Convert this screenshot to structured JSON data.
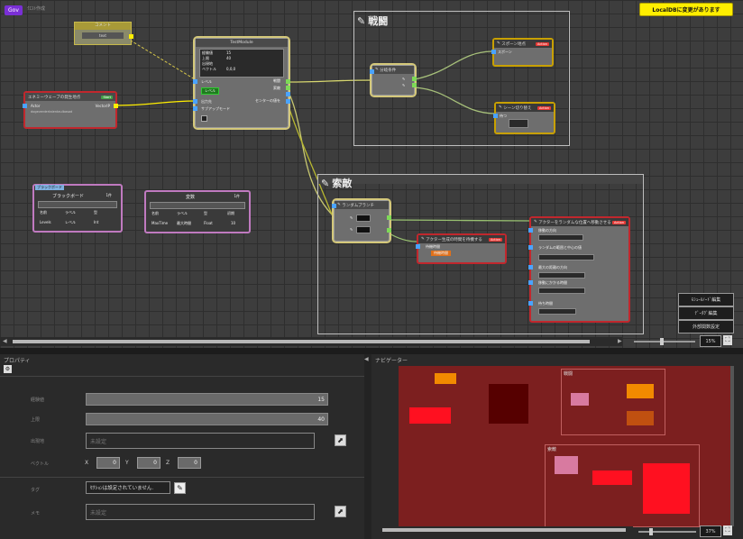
{
  "app": {
    "badge": "Gov",
    "caption": "ｸｴｽﾄ作成"
  },
  "localdb_button": "LocalDBに変更があります",
  "groups": {
    "battle": "戦闘",
    "explore": "索敵"
  },
  "nodes": {
    "comment": {
      "title": "コメント",
      "value": "text"
    },
    "main": {
      "title": "TestModule",
      "rows": [
        "経験値",
        "上限",
        "出現地",
        "ベクトル"
      ],
      "vals": [
        "15",
        "40",
        "",
        "0,0,0"
      ],
      "level": "レベル",
      "level_val": "レベル",
      "route": "出力先",
      "sub": "サブアップモード",
      "outs": [
        "戦闘",
        "索敵"
      ],
      "center": "センターの値を"
    },
    "entry": {
      "title": "エネミーウェーブの発生地点",
      "tag": "Start",
      "actor": "Actor",
      "vec": "VectorIP",
      "text": "dogeverdertalentaulbasad"
    },
    "branch_top": {
      "title": "分岐条件"
    },
    "spawn": {
      "title": "スポーン地点",
      "tag": "Action",
      "label": "スポーン"
    },
    "wait": {
      "title": "シーン切り替え",
      "tag": "Action",
      "label": "待つ"
    },
    "blackboard": {
      "title": "ブラックボード",
      "badge": "ブラックボード",
      "dropdown": "1件",
      "header": [
        "名前",
        "ラベル",
        "型"
      ],
      "row": [
        "Levels",
        "レベル",
        "Int"
      ]
    },
    "vars": {
      "title": "変数",
      "dropdown": "1件",
      "header": [
        "名前",
        "ラベル",
        "型",
        "初期"
      ],
      "row": [
        "MaxTime",
        "最大時間",
        "Float",
        "10"
      ]
    },
    "explore_branch": {
      "title": "ランダムブランチ"
    },
    "explore_mid": {
      "title": "アクター生成の時間を待機する",
      "tag": "Action",
      "sub": "待機時間",
      "btn": "待機時間"
    },
    "explore_right": {
      "title": "アクターをランダムな位置へ移動させる",
      "tag": "Action",
      "rows": [
        "移動の方向",
        "ランダムの範囲と中心の値",
        "最大の距離の方向",
        "移動にかかる時間",
        "待ち時間"
      ]
    }
  },
  "side_buttons": [
    "ﾓｼｭｰﾙﾉｰﾄﾞ編集",
    "ﾃﾞｰﾀｸﾞ編集",
    "外部関数設定"
  ],
  "canvas_zoom": "15%",
  "properties": {
    "title": "プロパティ",
    "labels": [
      "経験値",
      "上限",
      "出現地",
      "ベクトル",
      "タグ",
      "メモ"
    ],
    "exp": "15",
    "limit": "40",
    "spawn_placeholder": "未設定",
    "vector": {
      "x_label": "X",
      "y_label": "Y",
      "z_label": "Z",
      "x": "0",
      "y": "0",
      "z": "0"
    },
    "tag_value": "ｾｸｼｮﾝは設定されていません.",
    "memo_placeholder": "未設定"
  },
  "navigator": {
    "title": "ナビゲーター",
    "battle": "戦闘",
    "explore": "索敵",
    "zoom": "37%"
  }
}
